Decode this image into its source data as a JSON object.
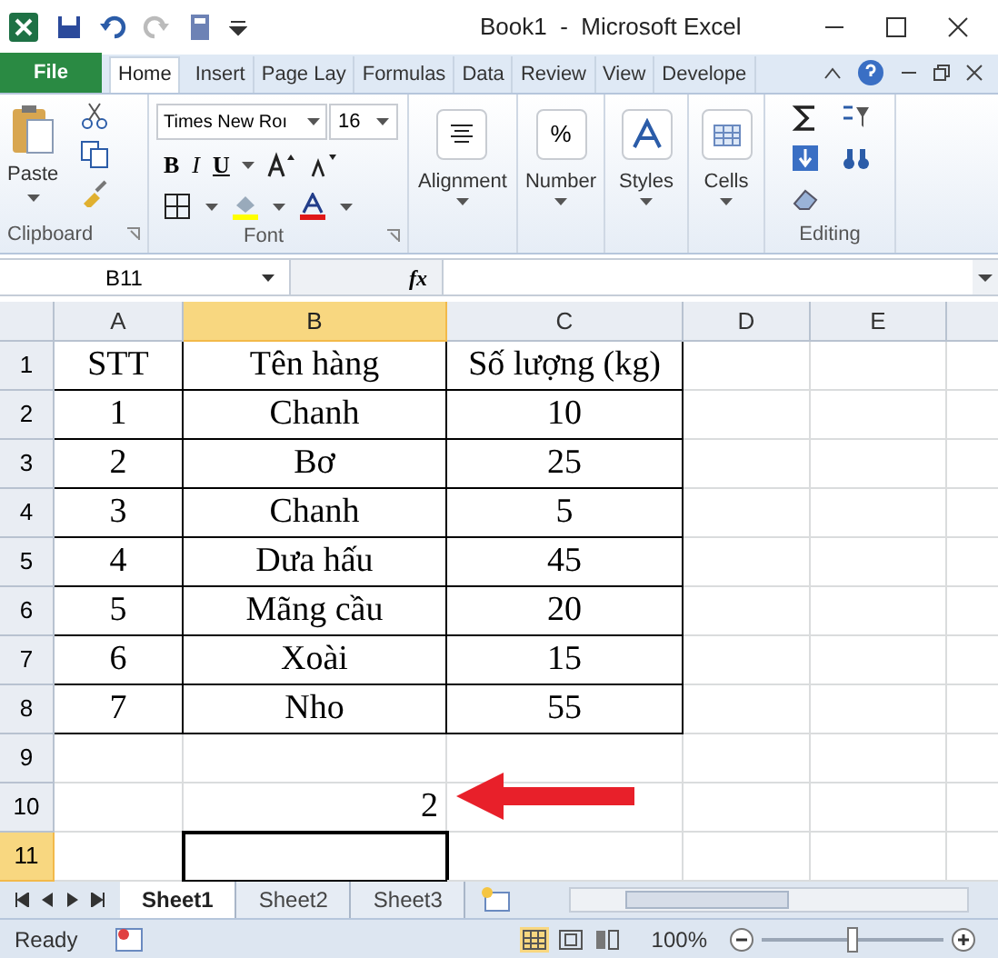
{
  "window": {
    "title": "Book1  -  Microsoft Excel"
  },
  "tabs": [
    {
      "label": "File",
      "kind": "file",
      "selected": false
    },
    {
      "label": "Home",
      "kind": "tab",
      "selected": true
    },
    {
      "label": "Insert",
      "kind": "tab",
      "selected": false
    },
    {
      "label": "Page Lay",
      "kind": "tab",
      "selected": false
    },
    {
      "label": "Formulas",
      "kind": "tab",
      "selected": false
    },
    {
      "label": "Data",
      "kind": "tab",
      "selected": false
    },
    {
      "label": "Review",
      "kind": "tab",
      "selected": false
    },
    {
      "label": "View",
      "kind": "tab",
      "selected": false
    },
    {
      "label": "Develope",
      "kind": "tab",
      "selected": false
    }
  ],
  "ribbon": {
    "paste": "Paste",
    "clipboard": "Clipboard",
    "font_name": "Times New Roı",
    "font_size": "16",
    "font": "Font",
    "bold": "B",
    "italic": "I",
    "underline": "U",
    "alignment": "Alignment",
    "number": "Number",
    "number_symbol": "%",
    "styles": "Styles",
    "cells": "Cells",
    "editing": "Editing"
  },
  "formula_bar": {
    "name_box": "B11",
    "fx": "fx"
  },
  "columns": [
    {
      "label": "A",
      "selected": false
    },
    {
      "label": "B",
      "selected": true
    },
    {
      "label": "C",
      "selected": false
    },
    {
      "label": "D",
      "selected": false
    },
    {
      "label": "E",
      "selected": false
    }
  ],
  "rows": [
    {
      "header": "1",
      "kind": "table",
      "selected": false,
      "A": "STT",
      "B": "Tên hàng",
      "C": "Số lượng (kg)"
    },
    {
      "header": "2",
      "kind": "table",
      "selected": false,
      "A": "1",
      "B": "Chanh",
      "C": "10"
    },
    {
      "header": "3",
      "kind": "table",
      "selected": false,
      "A": "2",
      "B": "Bơ",
      "C": "25"
    },
    {
      "header": "4",
      "kind": "table",
      "selected": false,
      "A": "3",
      "B": "Chanh",
      "C": "5"
    },
    {
      "header": "5",
      "kind": "table",
      "selected": false,
      "A": "4",
      "B": "Dưa hấu",
      "C": "45"
    },
    {
      "header": "6",
      "kind": "table",
      "selected": false,
      "A": "5",
      "B": "Mãng cầu",
      "C": "20"
    },
    {
      "header": "7",
      "kind": "table",
      "selected": false,
      "A": "6",
      "B": "Xoài",
      "C": "15"
    },
    {
      "header": "8",
      "kind": "table",
      "selected": false,
      "A": "7",
      "B": "Nho",
      "C": "55"
    },
    {
      "header": "9",
      "kind": "plain",
      "selected": false
    },
    {
      "header": "10",
      "kind": "plain",
      "selected": false,
      "B": "2"
    },
    {
      "header": "11",
      "kind": "plain",
      "selected": true
    }
  ],
  "sheets": [
    {
      "label": "Sheet1",
      "selected": true
    },
    {
      "label": "Sheet2",
      "selected": false
    },
    {
      "label": "Sheet3",
      "selected": false
    }
  ],
  "status_bar": {
    "status": "Ready",
    "zoom": "100%",
    "zoom_slider": {
      "level": 0.5
    }
  }
}
